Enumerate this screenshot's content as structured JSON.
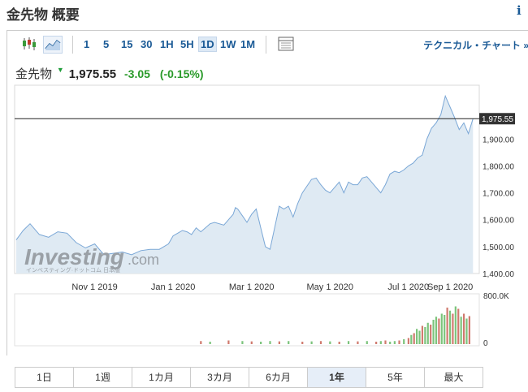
{
  "header": {
    "title": "金先物 概要",
    "info_label": "i"
  },
  "toolbar": {
    "timeframes": [
      "1",
      "5",
      "15",
      "30",
      "1H",
      "5H",
      "1D",
      "1W",
      "1M"
    ],
    "active_timeframe": "1D",
    "technical_link": "テクニカル・チャート »"
  },
  "quote": {
    "name": "金先物",
    "price": "1,975.55",
    "change": "-3.05",
    "change_pct": "(-0.15%)"
  },
  "watermark": {
    "brand": "Investing",
    "suffix": ".com",
    "tagline": "インベスティング·ドットコム 日本版"
  },
  "colors": {
    "line": "#7aa7d6",
    "area": "#dfeaf3",
    "up": "#7cc47c",
    "down": "#d07a6e",
    "accent": "#1a5a96"
  },
  "chart_data": {
    "type": "area",
    "ylim": [
      1400,
      2100
    ],
    "y_ticks": [
      1400,
      1500,
      1600,
      1700,
      1800,
      1900
    ],
    "y_tick_labels": [
      "1,400.00",
      "1,500.00",
      "1,600.00",
      "1,700.00",
      "1,800.00",
      "1,900.00"
    ],
    "x_ticks": [
      "Nov 1 2019",
      "Jan 1 2020",
      "Mar 1 2020",
      "May 1 2020",
      "Jul 1 2020",
      "Sep 1 2020"
    ],
    "x_range": [
      0,
      100
    ],
    "x_tick_positions": [
      17,
      34,
      51,
      68,
      85,
      99
    ],
    "last_price": 1975.55,
    "last_price_label": "1,975.55",
    "series": [
      {
        "values": [
          [
            0,
            1525
          ],
          [
            1.5,
            1560
          ],
          [
            3,
            1585
          ],
          [
            5,
            1545
          ],
          [
            7,
            1535
          ],
          [
            9,
            1555
          ],
          [
            11,
            1550
          ],
          [
            13,
            1515
          ],
          [
            15,
            1495
          ],
          [
            17,
            1510
          ],
          [
            19,
            1470
          ],
          [
            21,
            1475
          ],
          [
            23,
            1480
          ],
          [
            25,
            1470
          ],
          [
            27,
            1485
          ],
          [
            29,
            1490
          ],
          [
            31,
            1490
          ],
          [
            33,
            1510
          ],
          [
            34,
            1540
          ],
          [
            35,
            1550
          ],
          [
            36,
            1560
          ],
          [
            37,
            1555
          ],
          [
            38,
            1545
          ],
          [
            39,
            1570
          ],
          [
            40,
            1555
          ],
          [
            41,
            1570
          ],
          [
            42,
            1585
          ],
          [
            43,
            1590
          ],
          [
            45,
            1580
          ],
          [
            46,
            1600
          ],
          [
            47,
            1620
          ],
          [
            47.5,
            1645
          ],
          [
            48,
            1640
          ],
          [
            49,
            1615
          ],
          [
            50,
            1590
          ],
          [
            51,
            1620
          ],
          [
            52,
            1640
          ],
          [
            53,
            1570
          ],
          [
            54,
            1500
          ],
          [
            55,
            1490
          ],
          [
            56,
            1570
          ],
          [
            57,
            1650
          ],
          [
            58,
            1640
          ],
          [
            59,
            1650
          ],
          [
            60,
            1610
          ],
          [
            61,
            1660
          ],
          [
            62,
            1700
          ],
          [
            64,
            1750
          ],
          [
            65,
            1755
          ],
          [
            66,
            1730
          ],
          [
            67,
            1710
          ],
          [
            68,
            1700
          ],
          [
            69,
            1720
          ],
          [
            70,
            1740
          ],
          [
            71,
            1700
          ],
          [
            72,
            1740
          ],
          [
            73,
            1730
          ],
          [
            74,
            1730
          ],
          [
            75,
            1755
          ],
          [
            76,
            1760
          ],
          [
            77,
            1740
          ],
          [
            78,
            1720
          ],
          [
            79,
            1700
          ],
          [
            80,
            1730
          ],
          [
            81,
            1770
          ],
          [
            82,
            1780
          ],
          [
            83,
            1775
          ],
          [
            84,
            1785
          ],
          [
            85,
            1800
          ],
          [
            86,
            1810
          ],
          [
            87,
            1830
          ],
          [
            88,
            1840
          ],
          [
            89,
            1900
          ],
          [
            90,
            1940
          ],
          [
            91,
            1960
          ],
          [
            92,
            1990
          ],
          [
            93,
            2060
          ],
          [
            94,
            2020
          ],
          [
            95,
            1980
          ],
          [
            96,
            1935
          ],
          [
            97,
            1960
          ],
          [
            98,
            1920
          ],
          [
            99,
            1975.55
          ]
        ]
      }
    ],
    "volume": {
      "ylim": [
        0,
        800000
      ],
      "y_tick_labels": [
        "800.0K",
        "0"
      ],
      "values": [
        [
          40,
          50000,
          "down"
        ],
        [
          42,
          40000,
          "up"
        ],
        [
          46,
          60000,
          "down"
        ],
        [
          49,
          50000,
          "up"
        ],
        [
          51,
          45000,
          "down"
        ],
        [
          53,
          40000,
          "up"
        ],
        [
          55,
          50000,
          "up"
        ],
        [
          57,
          45000,
          "down"
        ],
        [
          59,
          50000,
          "up"
        ],
        [
          62,
          40000,
          "down"
        ],
        [
          64,
          45000,
          "up"
        ],
        [
          66,
          50000,
          "down"
        ],
        [
          68,
          45000,
          "up"
        ],
        [
          70,
          40000,
          "down"
        ],
        [
          72,
          50000,
          "up"
        ],
        [
          74,
          45000,
          "down"
        ],
        [
          76,
          50000,
          "up"
        ],
        [
          78,
          40000,
          "down"
        ],
        [
          79,
          50000,
          "up"
        ],
        [
          80,
          60000,
          "down"
        ],
        [
          81,
          40000,
          "up"
        ],
        [
          82,
          50000,
          "up"
        ],
        [
          83,
          60000,
          "down"
        ],
        [
          84,
          80000,
          "up"
        ],
        [
          85,
          100000,
          "down"
        ],
        [
          85.6,
          150000,
          "up"
        ],
        [
          86.2,
          180000,
          "down"
        ],
        [
          86.8,
          250000,
          "up"
        ],
        [
          87.4,
          220000,
          "up"
        ],
        [
          88,
          300000,
          "down"
        ],
        [
          88.6,
          280000,
          "up"
        ],
        [
          89.2,
          350000,
          "up"
        ],
        [
          89.8,
          320000,
          "down"
        ],
        [
          90.4,
          400000,
          "up"
        ],
        [
          91,
          450000,
          "up"
        ],
        [
          91.6,
          420000,
          "down"
        ],
        [
          92.2,
          500000,
          "up"
        ],
        [
          92.8,
          480000,
          "up"
        ],
        [
          93.4,
          600000,
          "down"
        ],
        [
          94,
          550000,
          "up"
        ],
        [
          94.6,
          500000,
          "down"
        ],
        [
          95.2,
          620000,
          "up"
        ],
        [
          95.8,
          580000,
          "down"
        ],
        [
          96.4,
          450000,
          "up"
        ],
        [
          97,
          500000,
          "down"
        ],
        [
          97.6,
          420000,
          "up"
        ],
        [
          98.2,
          460000,
          "down"
        ]
      ]
    }
  },
  "periods": [
    "1日",
    "1週",
    "1カ月",
    "3カ月",
    "6カ月",
    "1年",
    "5年",
    "最大"
  ],
  "active_period": "1年"
}
